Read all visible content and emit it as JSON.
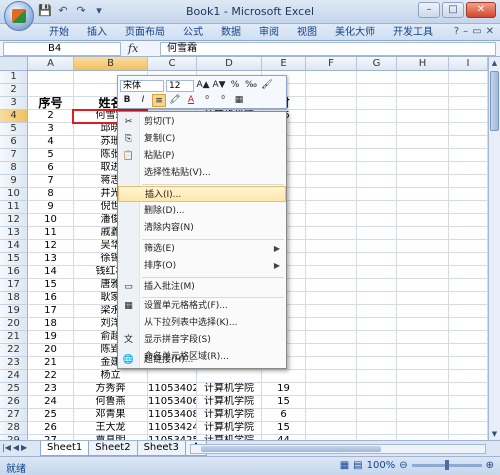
{
  "window": {
    "title": "Book1 - Microsoft Excel"
  },
  "ribbon": {
    "tabs": [
      "开始",
      "插入",
      "页面布局",
      "公式",
      "数据",
      "审阅",
      "视图",
      "美化大师",
      "开发工具"
    ]
  },
  "formula": {
    "name_box": "B4",
    "fx": "fx",
    "value": "何雪霜"
  },
  "columns": [
    "A",
    "B",
    "C",
    "D",
    "E",
    "F",
    "G",
    "H",
    "I",
    "J"
  ],
  "rows": [
    {
      "n": "1",
      "a": "",
      "b": "",
      "c": "",
      "d": "",
      "e": ""
    },
    {
      "n": "2",
      "a": "",
      "b": "",
      "c": "",
      "d": "",
      "e": ""
    },
    {
      "n": "3",
      "a": "序号",
      "b": "姓名",
      "c": "",
      "d": "",
      "e": "时"
    },
    {
      "n": "4",
      "a": "2",
      "b": "何雪霜",
      "c": "11053100",
      "d": "计算机学院",
      "e": "15"
    },
    {
      "n": "5",
      "a": "3",
      "b": "邱晓",
      "c": "",
      "d": "",
      "e": ""
    },
    {
      "n": "6",
      "a": "4",
      "b": "苏珊",
      "c": "",
      "d": "",
      "e": ""
    },
    {
      "n": "7",
      "a": "5",
      "b": "陈张",
      "c": "",
      "d": "",
      "e": ""
    },
    {
      "n": "8",
      "a": "6",
      "b": "取进",
      "c": "",
      "d": "",
      "e": ""
    },
    {
      "n": "9",
      "a": "7",
      "b": "蒋志",
      "c": "",
      "d": "",
      "e": ""
    },
    {
      "n": "10",
      "a": "8",
      "b": "井光",
      "c": "",
      "d": "",
      "e": ""
    },
    {
      "n": "11",
      "a": "9",
      "b": "倪世",
      "c": "",
      "d": "",
      "e": ""
    },
    {
      "n": "12",
      "a": "10",
      "b": "潘俊",
      "c": "",
      "d": "",
      "e": ""
    },
    {
      "n": "13",
      "a": "11",
      "b": "戚鑫",
      "c": "",
      "d": "",
      "e": ""
    },
    {
      "n": "14",
      "a": "12",
      "b": "吴华",
      "c": "",
      "d": "",
      "e": ""
    },
    {
      "n": "15",
      "a": "13",
      "b": "徐锡",
      "c": "",
      "d": "",
      "e": ""
    },
    {
      "n": "16",
      "a": "14",
      "b": "钱红林",
      "c": "",
      "d": "",
      "e": ""
    },
    {
      "n": "17",
      "a": "15",
      "b": "唐雅",
      "c": "",
      "d": "",
      "e": ""
    },
    {
      "n": "18",
      "a": "16",
      "b": "耿家",
      "c": "",
      "d": "",
      "e": ""
    },
    {
      "n": "19",
      "a": "17",
      "b": "梁永",
      "c": "",
      "d": "",
      "e": ""
    },
    {
      "n": "20",
      "a": "18",
      "b": "刘洋",
      "c": "",
      "d": "",
      "e": ""
    },
    {
      "n": "21",
      "a": "19",
      "b": "俞超",
      "c": "",
      "d": "",
      "e": ""
    },
    {
      "n": "22",
      "a": "20",
      "b": "陈郢",
      "c": "",
      "d": "",
      "e": ""
    },
    {
      "n": "23",
      "a": "21",
      "b": "金建",
      "c": "",
      "d": "",
      "e": ""
    },
    {
      "n": "24",
      "a": "22",
      "b": "杨立",
      "c": "",
      "d": "",
      "e": ""
    },
    {
      "n": "25",
      "a": "23",
      "b": "方秀奔",
      "c": "11053402",
      "d": "计算机学院",
      "e": "19"
    },
    {
      "n": "26",
      "a": "24",
      "b": "何鲁燕",
      "c": "11053406",
      "d": "计算机学院",
      "e": "15"
    },
    {
      "n": "27",
      "a": "25",
      "b": "邓青果",
      "c": "11053408",
      "d": "计算机学院",
      "e": "6"
    },
    {
      "n": "28",
      "a": "26",
      "b": "王大龙",
      "c": "11053424",
      "d": "计算机学院",
      "e": "15"
    },
    {
      "n": "29",
      "a": "27",
      "b": "覃具明",
      "c": "11053425",
      "d": "计算机学院",
      "e": "44"
    },
    {
      "n": "30",
      "a": "28",
      "b": "侯考玲",
      "c": "11053503",
      "d": "计算机学院",
      "e": "15"
    }
  ],
  "mini_toolbar": {
    "font": "宋体",
    "size": "12",
    "row1_icons": [
      "A▲",
      "A▼",
      "%",
      "‰",
      "🖌"
    ],
    "row2_icons": [
      "B",
      "I",
      "≡",
      "🖍",
      "A",
      "⁰",
      "⁰",
      "▦"
    ]
  },
  "context_menu": {
    "items": [
      {
        "label": "剪切(T)",
        "icon": "✂"
      },
      {
        "label": "复制(C)",
        "icon": "⎘"
      },
      {
        "label": "粘贴(P)",
        "icon": "📋"
      },
      {
        "label": "选择性粘贴(V)...",
        "icon": ""
      },
      {
        "label": "插入(I)...",
        "icon": ""
      },
      {
        "label": "删除(D)...",
        "icon": ""
      },
      {
        "label": "清除内容(N)",
        "icon": ""
      },
      {
        "label": "筛选(E)",
        "icon": ""
      },
      {
        "label": "排序(O)",
        "icon": ""
      },
      {
        "label": "插入批注(M)",
        "icon": "▭"
      },
      {
        "label": "设置单元格格式(F)...",
        "icon": "▦"
      },
      {
        "label": "从下拉列表中选择(K)...",
        "icon": ""
      },
      {
        "label": "显示拼音字段(S)",
        "icon": "文"
      },
      {
        "label": "命名单元格区域(R)...",
        "icon": ""
      },
      {
        "label": "超链接(H)...",
        "icon": "🌐"
      }
    ]
  },
  "sheets": [
    "Sheet1",
    "Sheet2",
    "Sheet3"
  ],
  "status": {
    "text": "就绪",
    "zoom": "100%"
  }
}
